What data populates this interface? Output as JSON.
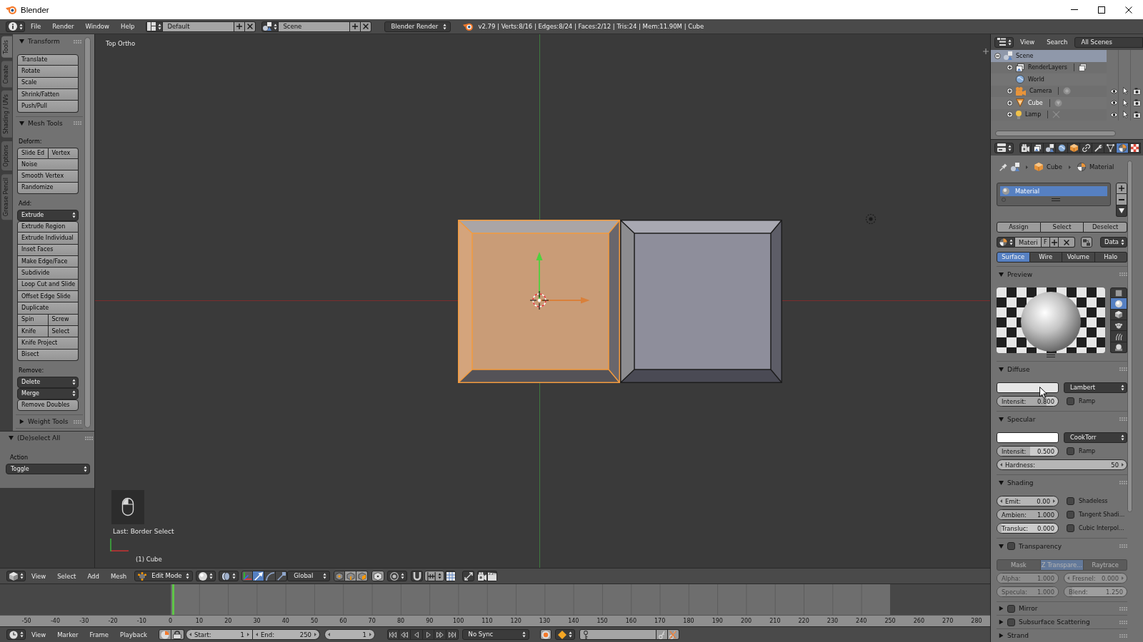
{
  "window": {
    "title": "Blender"
  },
  "info_header": {
    "menus": [
      "File",
      "Render",
      "Window",
      "Help"
    ],
    "screen_layout": "Default",
    "scene": "Scene",
    "render_engine": "Blender Render",
    "stats": "v2.79 | Verts:8/16 | Edges:8/24 | Faces:2/12 | Tris:24 | Mem:11.90M | Cube"
  },
  "tool_shelf": {
    "tabs": [
      {
        "label": "Tools",
        "selected": true
      },
      {
        "label": "Create",
        "selected": false
      },
      {
        "label": "Shading / UVs",
        "selected": false
      },
      {
        "label": "Options",
        "selected": false
      },
      {
        "label": "Grease Pencil",
        "selected": false
      }
    ],
    "panels": [
      {
        "title": "Transform",
        "expanded": true,
        "items": [
          {
            "kind": "buttons",
            "rows": [
              [
                "Translate"
              ],
              [
                "Rotate"
              ],
              [
                "Scale"
              ],
              [
                "Shrink/Fatten"
              ],
              [
                "Push/Pull"
              ]
            ]
          }
        ]
      },
      {
        "title": "Mesh Tools",
        "expanded": true,
        "items": [
          {
            "kind": "label",
            "text": "Deform:"
          },
          {
            "kind": "buttons",
            "rows": [
              [
                "Slide Ed",
                "Vertex"
              ],
              [
                "Noise"
              ],
              [
                "Smooth Vertex"
              ],
              [
                "Randomize"
              ]
            ]
          },
          {
            "kind": "label",
            "text": "Add:"
          },
          {
            "kind": "menu",
            "text": "Extrude"
          },
          {
            "kind": "buttons",
            "rows": [
              [
                "Extrude Region"
              ],
              [
                "Extrude Individual"
              ],
              [
                "Inset Faces"
              ],
              [
                "Make Edge/Face"
              ],
              [
                "Subdivide"
              ],
              [
                "Loop Cut and Slide"
              ],
              [
                "Offset Edge Slide"
              ],
              [
                "Duplicate"
              ],
              [
                "Spin",
                "Screw"
              ],
              [
                "Knife",
                "Select"
              ],
              [
                "Knife Project"
              ],
              [
                "Bisect"
              ]
            ]
          },
          {
            "kind": "label",
            "text": "Remove:"
          },
          {
            "kind": "menu",
            "text": "Delete"
          },
          {
            "kind": "menu",
            "text": "Merge"
          },
          {
            "kind": "buttons",
            "rows": [
              [
                "Remove Doubles"
              ]
            ]
          }
        ]
      },
      {
        "title": "Weight Tools",
        "expanded": false
      }
    ]
  },
  "operator_panel": {
    "title": "(De)select All",
    "expanded": true,
    "label": "Action",
    "value": "Toggle"
  },
  "viewport": {
    "view_name": "Top Ortho",
    "last_operator": "Last: Border Select",
    "object_info": "(1) Cube",
    "mesh_blocks": [
      {
        "selected": true
      },
      {
        "selected": false
      }
    ]
  },
  "view3d_header": {
    "menus": [
      "View",
      "Select",
      "Add",
      "Mesh"
    ],
    "mode": "Edit Mode",
    "orientation": "Global",
    "manipulators": [
      {
        "kind": "toggle",
        "selected": true
      },
      {
        "kind": "translate",
        "selected": true
      },
      {
        "kind": "rotate",
        "selected": false
      },
      {
        "kind": "scale",
        "selected": false
      }
    ],
    "select_modes": [
      {
        "kind": "vertex",
        "selected": true
      },
      {
        "kind": "edge",
        "selected": false
      },
      {
        "kind": "face",
        "selected": false
      }
    ]
  },
  "timeline": {
    "ruler": [
      "-50",
      "-40",
      "-30",
      "-20",
      "-10",
      "0",
      "10",
      "20",
      "30",
      "40",
      "50",
      "60",
      "70",
      "80",
      "90",
      "100",
      "110",
      "120",
      "130",
      "140",
      "150",
      "160",
      "170",
      "180",
      "190",
      "200",
      "210",
      "220",
      "230",
      "240",
      "250",
      "260",
      "270",
      "280"
    ],
    "menus": [
      "View",
      "Marker",
      "Frame",
      "Playback"
    ],
    "start": {
      "label": "Start:",
      "value": "1"
    },
    "end": {
      "label": "End:",
      "value": "250"
    },
    "current": "1",
    "sync": "No Sync"
  },
  "outliner": {
    "menus": [
      "View",
      "Search"
    ],
    "display_mode": "All Scenes",
    "tree": [
      {
        "name": "Scene",
        "kind": "scene",
        "expanded": true,
        "selected": true,
        "active": false,
        "children": [
          {
            "name": "RenderLayers",
            "kind": "render_layers",
            "expanded": false,
            "selected": false,
            "active": false
          },
          {
            "name": "World",
            "kind": "world",
            "selected": false,
            "active": false
          },
          {
            "name": "Camera",
            "kind": "camera",
            "expanded": false,
            "selected": false,
            "active": false
          },
          {
            "name": "Cube",
            "kind": "mesh",
            "expanded": false,
            "selected": false,
            "active": true
          },
          {
            "name": "Lamp",
            "kind": "lamp",
            "expanded": false,
            "selected": false,
            "active": false
          }
        ]
      }
    ]
  },
  "properties": {
    "tabs": [
      {
        "kind": "render",
        "selected": false
      },
      {
        "kind": "render_layers",
        "selected": false
      },
      {
        "kind": "scene",
        "selected": false
      },
      {
        "kind": "world",
        "selected": false
      },
      {
        "kind": "object",
        "selected": false
      },
      {
        "kind": "constraints",
        "selected": false
      },
      {
        "kind": "modifiers",
        "selected": false
      },
      {
        "kind": "data",
        "selected": false
      },
      {
        "kind": "material",
        "selected": true
      },
      {
        "kind": "texture",
        "selected": false
      }
    ],
    "breadcrumb": [
      {
        "kind": "object",
        "text": "Cube"
      },
      {
        "kind": "material",
        "text": "Material"
      }
    ],
    "material_slots": [
      {
        "name": "Material",
        "selected": true
      }
    ],
    "slot_actions": [
      "Assign",
      "Select",
      "Deselect"
    ],
    "material_field": {
      "name": "Materi",
      "fake_user": "F",
      "link": "Data"
    },
    "context_tabs": [
      {
        "label": "Surface",
        "selected": true
      },
      {
        "label": "Wire",
        "selected": false
      },
      {
        "label": "Volume",
        "selected": false
      },
      {
        "label": "Halo",
        "selected": false
      }
    ],
    "panels": [
      {
        "kind": "preview",
        "title": "Preview",
        "expanded": true,
        "shapes": [
          {
            "kind": "plane",
            "selected": false
          },
          {
            "kind": "sphere",
            "selected": true
          },
          {
            "kind": "cube",
            "selected": false
          },
          {
            "kind": "monkey",
            "selected": false
          },
          {
            "kind": "hair",
            "selected": false
          },
          {
            "kind": "sky",
            "selected": false
          }
        ]
      },
      {
        "kind": "plain",
        "title": "Diffuse",
        "expanded": true,
        "rows": [
          {
            "left": {
              "kind": "color",
              "color": "#e6e6e6"
            },
            "right": {
              "kind": "dropdown",
              "value": "Lambert"
            }
          },
          {
            "left": {
              "kind": "slider",
              "label": "Intensit:",
              "value": "0.800",
              "level": 0.8
            },
            "right": {
              "kind": "checkbox",
              "label": "Ramp",
              "checked": false
            }
          }
        ]
      },
      {
        "kind": "plain",
        "title": "Specular",
        "expanded": true,
        "rows": [
          {
            "left": {
              "kind": "color",
              "color": "#ffffff"
            },
            "right": {
              "kind": "dropdown",
              "value": "CookTorr"
            }
          },
          {
            "left": {
              "kind": "slider",
              "label": "Intensit:",
              "value": "0.500",
              "level": 0.5
            },
            "right": {
              "kind": "checkbox",
              "label": "Ramp",
              "checked": false
            }
          },
          {
            "full": {
              "kind": "number",
              "label": "Hardness:",
              "value": "50"
            }
          }
        ]
      },
      {
        "kind": "plain",
        "title": "Shading",
        "expanded": true,
        "rows": [
          {
            "left": {
              "kind": "number",
              "label": "Emit:",
              "value": "0.00"
            },
            "right": {
              "kind": "checkbox",
              "label": "Shadeless",
              "checked": false
            }
          },
          {
            "left": {
              "kind": "slider",
              "label": "Ambien:",
              "value": "1.000",
              "level": 1
            },
            "right": {
              "kind": "checkbox",
              "label": "Tangent Shadi...",
              "checked": false
            }
          },
          {
            "left": {
              "kind": "slider",
              "label": "Transluc:",
              "value": "0.000",
              "level": 0
            },
            "right": {
              "kind": "checkbox",
              "label": "Cubic Interpol...",
              "checked": false
            }
          }
        ]
      },
      {
        "kind": "toggle",
        "title": "Transparency",
        "expanded": true,
        "checked": false,
        "rows": [
          {
            "full": {
              "kind": "tabs",
              "items": [
                {
                  "label": "Mask",
                  "selected": false
                },
                {
                  "label": "Z Transpare...",
                  "selected": true
                },
                {
                  "label": "Raytrace",
                  "selected": false
                }
              ]
            }
          },
          {
            "left": {
              "kind": "slider",
              "label": "Alpha:",
              "value": "1.000",
              "level": 1
            },
            "right": {
              "kind": "number",
              "label": "Fresnel:",
              "value": "0.000"
            }
          },
          {
            "left": {
              "kind": "slider",
              "label": "Specula:",
              "value": "1.000",
              "level": 1
            },
            "right": {
              "kind": "slider",
              "label": "Blend:",
              "value": "1.250",
              "level": 0.06
            }
          }
        ]
      },
      {
        "kind": "toggle",
        "title": "Mirror",
        "expanded": false,
        "checked": false
      },
      {
        "kind": "toggle",
        "title": "Subsurface Scattering",
        "expanded": false,
        "checked": false
      },
      {
        "kind": "plain",
        "title": "Strand",
        "expanded": false
      }
    ]
  }
}
